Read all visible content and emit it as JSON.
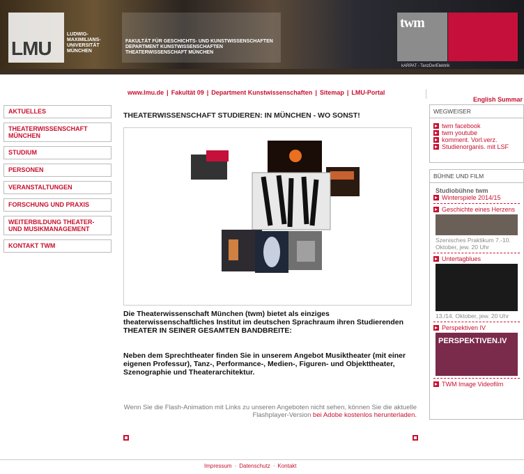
{
  "header": {
    "lmu_logo": "LMU",
    "university_lines": [
      "LUDWIG-",
      "MAXIMILIANS-",
      "UNIVERSITÄT",
      "MÜNCHEN"
    ],
    "faculty_lines": [
      "FAKULTÄT FÜR GESCHICHTS- UND KUNSTWISSENSCHAFTEN",
      "DEPARTMENT KUNSTWISSENSCHAFTEN",
      "THEATERWISSENSCHAFT MÜNCHEN"
    ],
    "twm_logo": "twm",
    "banner_credit": "kARPAT - TanzDerElektrik",
    "accent_color": "#c8102e"
  },
  "topnav": {
    "links": [
      "www.lmu.de",
      "Fakultät 09",
      "Department Kunstwissenschaften",
      "Sitemap",
      "LMU-Portal"
    ],
    "english": "English Summar"
  },
  "leftnav": {
    "items": [
      "AKTUELLES",
      "THEATERWISSENSCHAFT MÜNCHEN",
      "STUDIUM",
      "PERSONEN",
      "VERANSTALTUNGEN",
      "FORSCHUNG UND PRAXIS",
      "WEITERBILDUNG THEATER- UND MUSIKMANAGEMENT",
      "KONTAKT TWM"
    ]
  },
  "main": {
    "title": "THEATERWISSENSCHAFT STUDIEREN: IN MÜNCHEN - WO SONST!",
    "intro1": "Die Theaterwissenschaft München (twm) bietet als einziges theaterwissenschaftliches Institut im deutschen Sprachraum ihren Studierenden THEATER IN SEINER GESAMTEN BANDBREITE:",
    "intro2": "Neben dem Sprechtheater finden Sie in unserem Angebot Musiktheater (mit einer eigenen Professur), Tanz-, Performance-, Medien-, Figuren- und Objekttheater, Szenographie und Theaterarchitektur.",
    "flash_note": "Wenn Sie die Flash-Animation mit Links zu unseren Angeboten nicht sehen, können Sie die aktuelle Flashplayer-Version",
    "flash_link": "bei Adobe kostenlos herunterladen."
  },
  "wegweiser": {
    "head": "WEGWEISER",
    "links": [
      "twm facebook",
      "twm youtube",
      "komment. Vorl.verz.",
      "Studienorganis. mit LSF"
    ]
  },
  "buehne": {
    "head": "BÜHNE UND FILM",
    "subhead": "Studiobühne twm",
    "link1": "Winterspiele 2014/15",
    "link2": "Geschichte eines Herzens",
    "caption2": "Szenisches Praktikum 7.-10. Oktober, jew. 20 Uhr",
    "link3": "Untertagblues",
    "caption3": "13./14. Oktober, jew. 20 Uhr",
    "link4": "Perspektiven IV",
    "poster_text": "PERSPEKTIVEN.IV",
    "link5": "TWM Image Videofilm"
  },
  "footer": {
    "links": [
      "Impressum",
      "Datenschutz",
      "Kontakt"
    ]
  }
}
